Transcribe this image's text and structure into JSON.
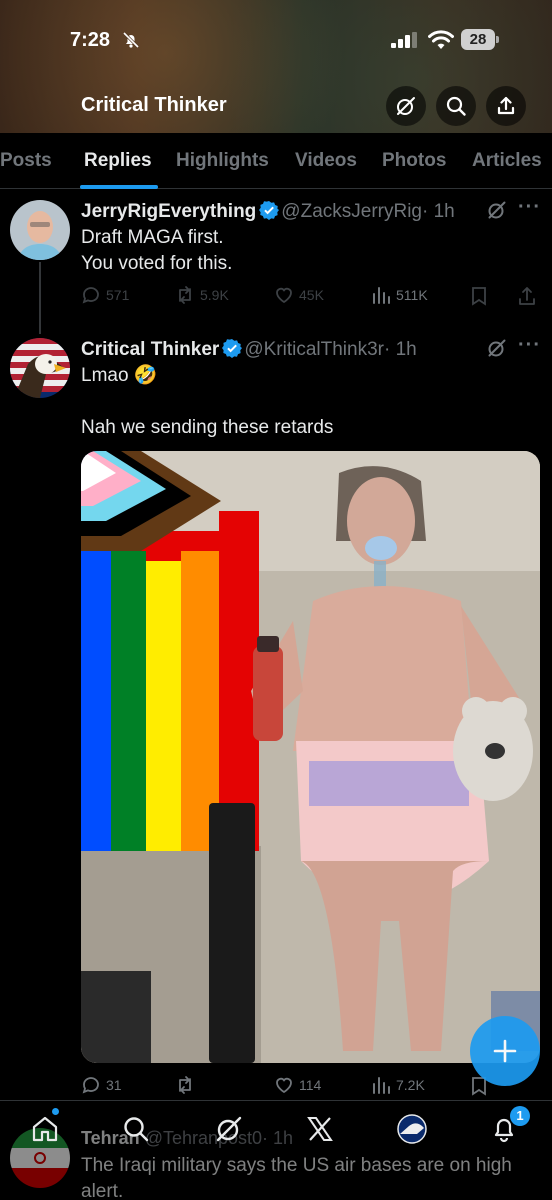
{
  "status": {
    "time": "7:28",
    "battery": "28"
  },
  "header": {
    "title": "Critical Thinker"
  },
  "tabs": [
    {
      "label": "Posts"
    },
    {
      "label": "Replies"
    },
    {
      "label": "Highlights"
    },
    {
      "label": "Videos"
    },
    {
      "label": "Photos"
    },
    {
      "label": "Articles"
    }
  ],
  "tweets": [
    {
      "name": "JerryRigEverything",
      "handle": "@ZacksJerryRig",
      "time": "· 1h",
      "text": "Draft MAGA first.\nYou voted for this.",
      "replies": "571",
      "reposts": "5.9K",
      "likes": "45K",
      "views": "511K"
    },
    {
      "name": "Critical Thinker",
      "handle": "@KriticalThink3r",
      "time": "· 1h",
      "text": "Lmao 🤣\n\nNah we sending these retards",
      "replies": "31",
      "likes": "114",
      "views": "7.2K"
    },
    {
      "name": "Tehran",
      "handle": "@Tehranpost0",
      "time": "· 1h",
      "text": "The Iraqi military says the US air bases are on high\nalert."
    }
  ],
  "notifications": {
    "count": "1"
  },
  "colors": {
    "accent": "#1d9bf0",
    "background": "#000000",
    "text": "#e7e9ea",
    "muted": "#71767b"
  }
}
